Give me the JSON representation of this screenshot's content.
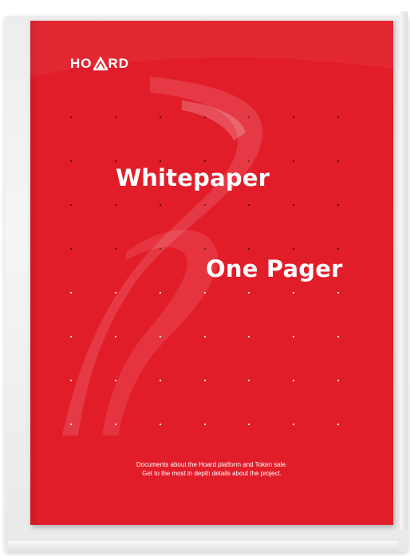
{
  "brand": {
    "logo_left": "HO",
    "logo_right": "RD",
    "logo_mark": "triangle-a-icon"
  },
  "cover": {
    "title": "Whitepaper",
    "subtitle": "One Pager",
    "description_line1": "Documents about the Hoard platform and Token sale.",
    "description_line2": "Get to the most in depth details about the project."
  },
  "colors": {
    "cover_red": "#e21d2a",
    "text": "#ffffff",
    "sleeve": "#eeeeee"
  }
}
